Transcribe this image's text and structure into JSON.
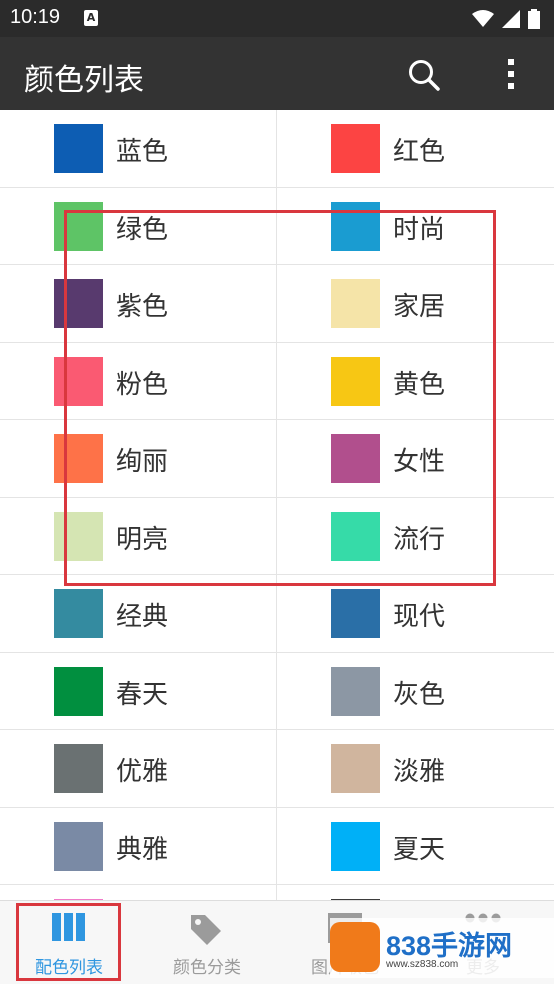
{
  "status_bar": {
    "time": "10:19",
    "notification_letter": "A"
  },
  "app_bar": {
    "title": "颜色列表"
  },
  "colors": [
    {
      "label": "蓝色",
      "color": "#0d5db3"
    },
    {
      "label": "红色",
      "color": "#fc4443"
    },
    {
      "label": "绿色",
      "color": "#5ec466"
    },
    {
      "label": "时尚",
      "color": "#1a9cd1"
    },
    {
      "label": "紫色",
      "color": "#583a6e"
    },
    {
      "label": "家居",
      "color": "#f5e4a8"
    },
    {
      "label": "粉色",
      "color": "#fa5a72"
    },
    {
      "label": "黄色",
      "color": "#f7c714"
    },
    {
      "label": "绚丽",
      "color": "#fe7248"
    },
    {
      "label": "女性",
      "color": "#b14f8d"
    },
    {
      "label": "明亮",
      "color": "#d5e5b3"
    },
    {
      "label": "流行",
      "color": "#36dba8"
    },
    {
      "label": "经典",
      "color": "#348ba0"
    },
    {
      "label": "现代",
      "color": "#2a6fa7"
    },
    {
      "label": "春天",
      "color": "#018f3f"
    },
    {
      "label": "灰色",
      "color": "#8c97a4"
    },
    {
      "label": "优雅",
      "color": "#6a7172"
    },
    {
      "label": "淡雅",
      "color": "#d0b59e"
    },
    {
      "label": "典雅",
      "color": "#7a8aa5"
    },
    {
      "label": "夏天",
      "color": "#00b0f7"
    },
    {
      "label": "",
      "color": "#f07ac8"
    },
    {
      "label": "",
      "color": "#3b3b3b"
    }
  ],
  "bottom_nav": {
    "items": [
      {
        "label": "配色列表",
        "icon": "columns-icon"
      },
      {
        "label": "颜色分类",
        "icon": "tags-icon"
      },
      {
        "label": "图片取色",
        "icon": "image-icon"
      },
      {
        "label": "更多",
        "icon": "more-dots-icon"
      }
    ]
  },
  "watermark": {
    "brand": "838手游网",
    "url": "www.sz838.com"
  },
  "colors_theme": {
    "active": "#2f96e0",
    "inactive": "#9b9b9b",
    "highlight": "#d9373e"
  }
}
